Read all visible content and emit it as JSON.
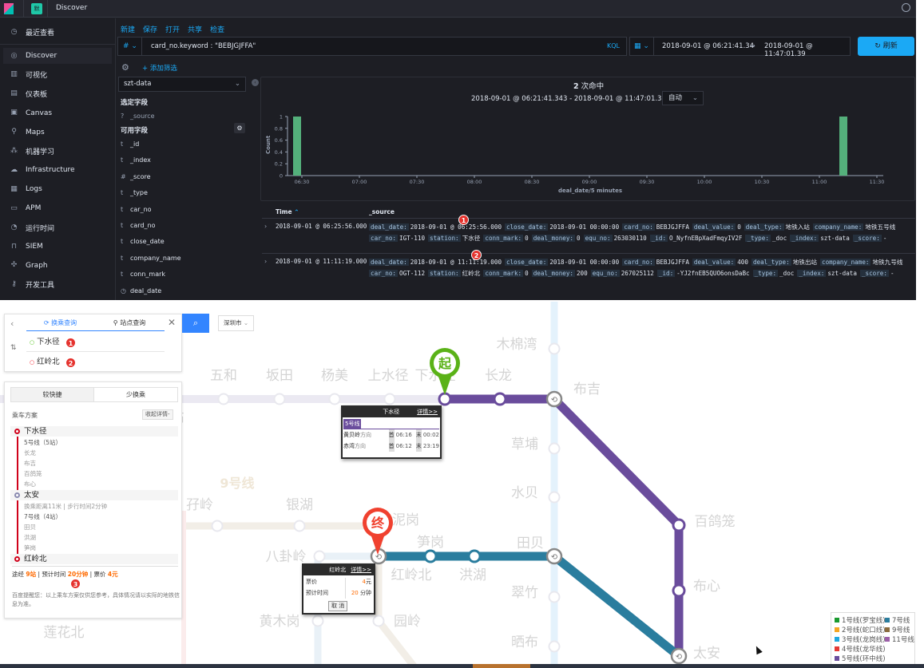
{
  "kibana": {
    "app_title": "Discover",
    "app_icon_letter": "默",
    "sidebar": {
      "recent": "最近查看",
      "items": [
        {
          "label": "Discover",
          "icon": "compass-icon"
        },
        {
          "label": "可视化",
          "icon": "visualize-icon"
        },
        {
          "label": "仪表板",
          "icon": "dashboard-icon"
        },
        {
          "label": "Canvas",
          "icon": "canvas-icon"
        },
        {
          "label": "Maps",
          "icon": "maps-icon"
        },
        {
          "label": "机器学习",
          "icon": "ml-icon"
        },
        {
          "label": "Infrastructure",
          "icon": "infrastructure-icon"
        },
        {
          "label": "Logs",
          "icon": "logs-icon"
        },
        {
          "label": "APM",
          "icon": "apm-icon"
        },
        {
          "label": "运行时间",
          "icon": "uptime-icon"
        },
        {
          "label": "SIEM",
          "icon": "siem-icon"
        },
        {
          "label": "Graph",
          "icon": "graph-icon"
        },
        {
          "label": "开发工具",
          "icon": "devtools-icon"
        }
      ]
    },
    "top_menu": [
      "新建",
      "保存",
      "打开",
      "共享",
      "检查"
    ],
    "query": {
      "type_symbol": "#",
      "value": "card_no.keyword : \"BEBJGJFFA\"",
      "language": "KQL"
    },
    "time": {
      "start": "2018-09-01 @ 06:21:41.34",
      "arrow": "→",
      "end": "2018-09-01 @ 11:47:01.39"
    },
    "refresh_label": "刷新",
    "add_filter": "+ 添加筛选",
    "index_pattern": "szt-data",
    "selected_fields_title": "选定字段",
    "selected_fields": [
      {
        "type": "?",
        "name": "_source"
      }
    ],
    "available_fields_title": "可用字段",
    "available_fields": [
      {
        "type": "t",
        "name": "_id"
      },
      {
        "type": "t",
        "name": "_index"
      },
      {
        "type": "#",
        "name": "_score"
      },
      {
        "type": "t",
        "name": "_type"
      },
      {
        "type": "t",
        "name": "car_no"
      },
      {
        "type": "t",
        "name": "card_no"
      },
      {
        "type": "t",
        "name": "close_date"
      },
      {
        "type": "t",
        "name": "company_name"
      },
      {
        "type": "t",
        "name": "conn_mark"
      },
      {
        "type": "clock",
        "name": "deal_date"
      }
    ],
    "hits": {
      "count": "2",
      "label": "次命中"
    },
    "range_text": "2018-09-01 @ 06:21:41.343 - 2018-09-01 @ 11:47:01.391 —",
    "interval": "自动",
    "table": {
      "headers": [
        "Time",
        "_source"
      ],
      "rows": [
        {
          "time": "2018-09-01 @ 06:25:56.000",
          "badge": "1",
          "line1": [
            [
              "deal_date:",
              "2018-09-01 @ 06:25:56.000"
            ],
            [
              "close_date:",
              "2018-09-01 00:00:00"
            ],
            [
              "card_no:",
              "BEBJGJFFA"
            ],
            [
              "deal_value:",
              "0"
            ],
            [
              "deal_type:",
              "地铁入站"
            ],
            [
              "company_name:",
              "地铁五号线"
            ]
          ],
          "line2": [
            [
              "car_no:",
              "IGT-110"
            ],
            [
              "station:",
              "下水径"
            ],
            [
              "conn_mark:",
              "0"
            ],
            [
              "deal_money:",
              "0"
            ],
            [
              "equ_no:",
              "263030110"
            ],
            [
              "_id:",
              "O_NyfnEBpXadFmqyIV2F"
            ],
            [
              "_type:",
              "_doc"
            ],
            [
              "_index:",
              "szt-data"
            ],
            [
              "_score:",
              "-"
            ]
          ]
        },
        {
          "time": "2018-09-01 @ 11:11:19.000",
          "badge": "2",
          "line1": [
            [
              "deal_date:",
              "2018-09-01 @ 11:11:19.000"
            ],
            [
              "close_date:",
              "2018-09-01 00:00:00"
            ],
            [
              "card_no:",
              "BEBJGJFFA"
            ],
            [
              "deal_value:",
              "400"
            ],
            [
              "deal_type:",
              "地铁出站"
            ],
            [
              "company_name:",
              "地铁九号线"
            ]
          ],
          "line2": [
            [
              "car_no:",
              "OGT-112"
            ],
            [
              "station:",
              "红岭北"
            ],
            [
              "conn_mark:",
              "0"
            ],
            [
              "deal_money:",
              "200"
            ],
            [
              "equ_no:",
              "267025112"
            ],
            [
              "_id:",
              "-YJ2fnEB5QUO6onsDaBc"
            ],
            [
              "_type:",
              "_doc"
            ],
            [
              "_index:",
              "szt-data"
            ],
            [
              "_score:",
              "-"
            ]
          ]
        }
      ]
    }
  },
  "chart_data": {
    "type": "bar",
    "xlabel": "deal_date/5 minutes",
    "ylabel": "Count",
    "x_ticks": [
      "06:30",
      "07:00",
      "07:30",
      "08:00",
      "08:30",
      "09:00",
      "09:30",
      "10:00",
      "10:30",
      "11:00",
      "11:30"
    ],
    "y_ticks": [
      0,
      0.2,
      0.4,
      0.6,
      0.8,
      1
    ],
    "ylim": [
      0,
      1
    ],
    "bars": [
      {
        "x": "06:25",
        "value": 1
      },
      {
        "x": "11:10",
        "value": 1
      }
    ],
    "bar_color": "#54b07b",
    "grid": false
  },
  "map": {
    "tabs": [
      "换乘查询",
      "站点查询"
    ],
    "from": "下水径",
    "to": "红岭北",
    "search_badges": [
      "1",
      "2"
    ],
    "city": "深圳市",
    "plan_tabs": [
      "较快捷",
      "少换乘"
    ],
    "plan_title": "乘车方案",
    "collapse_label": "收起详情-",
    "route": [
      {
        "station": "下水径",
        "line": "5号线（5站）",
        "stops": [
          "长龙",
          "布吉",
          "百鸽笼",
          "布心"
        ]
      },
      {
        "station": "太安",
        "transfer": "换乘距离11米 | 步行时间2分钟",
        "line": "7号线（4站）",
        "stops": [
          "田贝",
          "洪湖",
          "笋岗"
        ]
      },
      {
        "station": "红岭北"
      }
    ],
    "summary": {
      "via_label": "途经",
      "via": "9站",
      "time_label": "预计时间",
      "time": "20分钟",
      "price_label": "票价",
      "price": "4元",
      "badge": "3"
    },
    "notice": "百度提醒您：以上乘车方案仅供您参考，具体情况请以实际的地铁信息为准。",
    "legend": [
      {
        "label": "1号线(罗宝线)",
        "color": "#1a9a2f"
      },
      {
        "label": "2号线(蛇口线)",
        "color": "#f5a623"
      },
      {
        "label": "3号线(龙岗线)",
        "color": "#1fa8e0"
      },
      {
        "label": "4号线(龙华线)",
        "color": "#e53935"
      },
      {
        "label": "5号线(环中线)",
        "color": "#6a4c9c"
      },
      {
        "label": "7号线",
        "color": "#2a7d9e"
      },
      {
        "label": "9号线",
        "color": "#8b6c3e"
      },
      {
        "label": "11号线",
        "color": "#9c5fa8"
      }
    ],
    "line_label": "9号线",
    "stations": [
      "五和",
      "坂田",
      "杨美",
      "上水径",
      "下水径",
      "长龙",
      "布吉",
      "木棉湾",
      "草埔",
      "水贝",
      "百鸽笼",
      "布心",
      "太安",
      "红岭北",
      "笋岗",
      "洪湖",
      "田贝",
      "翠竹",
      "晒布",
      "孖岭",
      "银湖",
      "泥岗",
      "八卦岭",
      "黄木岗",
      "园岭",
      "莲花北",
      "站"
    ],
    "start_marker": "起",
    "end_marker": "终",
    "popup_start": {
      "title": "下水径",
      "detail": "详情>>",
      "line": "5号线",
      "rows": [
        {
          "dir": "黄贝岭",
          "dir_suffix": "方向",
          "first_label": "首",
          "first": "06:16",
          "last_label": "末",
          "last": "00:02"
        },
        {
          "dir": "赤湾",
          "dir_suffix": "方向",
          "first_label": "首",
          "first": "06:12",
          "last_label": "末",
          "last": "23:19"
        }
      ]
    },
    "popup_end": {
      "title": "红岭北",
      "detail": "详情>>",
      "price_label": "票价",
      "price_num": "4",
      "price_unit": "元",
      "time_label": "预计时间",
      "time_num": "20",
      "time_unit": "分钟",
      "cancel": "取 消"
    }
  }
}
